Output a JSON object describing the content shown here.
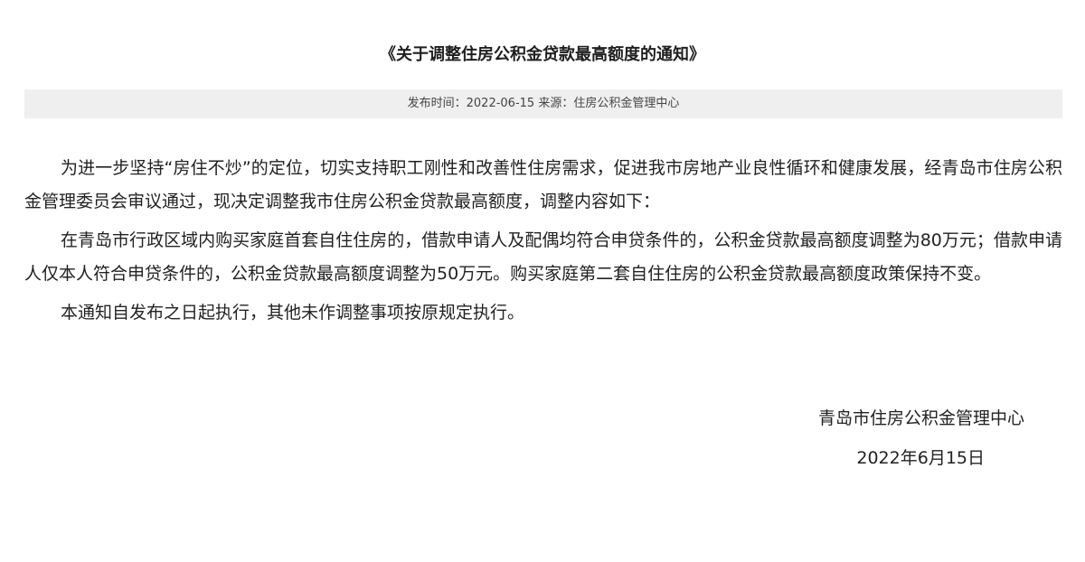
{
  "article": {
    "title": "《关于调整住房公积金贷款最高额度的通知》",
    "meta": {
      "date_label": "发布时间：",
      "date": "2022-06-15",
      "source_label": "来源：",
      "source": "住房公积金管理中心"
    },
    "paragraphs": [
      "为进一步坚持“房住不炒”的定位，切实支持职工刚性和改善性住房需求，促进我市房地产业良性循环和健康发展，经青岛市住房公积金管理委员会审议通过，现决定调整我市住房公积金贷款最高额度，调整内容如下：",
      "在青岛市行政区域内购买家庭首套自住住房的，借款申请人及配偶均符合申贷条件的，公积金贷款最高额度调整为80万元；借款申请人仅本人符合申贷条件的，公积金贷款最高额度调整为50万元。购买家庭第二套自住住房的公积金贷款最高额度政策保持不变。",
      "本通知自发布之日起执行，其他未作调整事项按原规定执行。"
    ],
    "signature": {
      "organization": "青岛市住房公积金管理中心",
      "date": "2022年6月15日"
    }
  }
}
